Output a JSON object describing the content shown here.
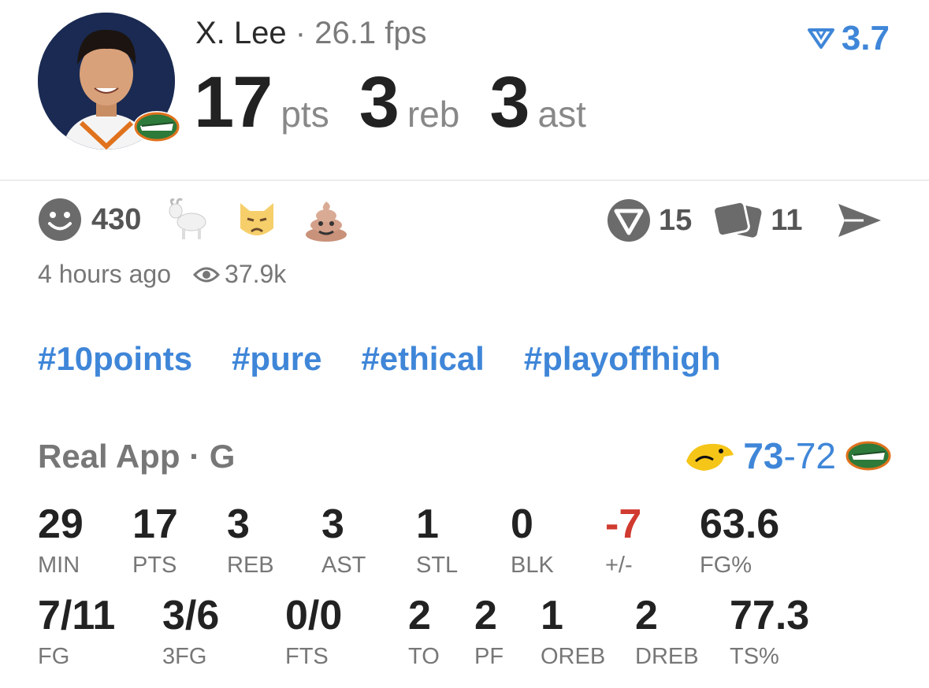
{
  "player": {
    "name": "X. Lee",
    "separator": "·",
    "fps": "26.1 fps"
  },
  "statline": [
    {
      "value": "17",
      "unit": "pts"
    },
    {
      "value": "3",
      "unit": "reb"
    },
    {
      "value": "3",
      "unit": "ast"
    }
  ],
  "rating": "3.7",
  "reactions": {
    "count": "430",
    "emojis": [
      "goat-emoji",
      "pouting-cat-emoji",
      "poop-emoji"
    ]
  },
  "actions": {
    "comments": "15",
    "cards": "11"
  },
  "meta": {
    "time": "4 hours ago",
    "views": "37.9k"
  },
  "tags": [
    "#10points",
    "#pure",
    "#ethical",
    "#playoffhigh"
  ],
  "game": {
    "title": "Real App · G",
    "score_home": "73",
    "score_dash": "-",
    "score_away": "72"
  },
  "box_row1": [
    {
      "value": "29",
      "label": "MIN"
    },
    {
      "value": "17",
      "label": "PTS"
    },
    {
      "value": "3",
      "label": "REB"
    },
    {
      "value": "3",
      "label": "AST"
    },
    {
      "value": "1",
      "label": "STL"
    },
    {
      "value": "0",
      "label": "BLK"
    },
    {
      "value": "-7",
      "label": "+/-"
    },
    {
      "value": "63.6",
      "label": "FG%"
    }
  ],
  "box_row2": [
    {
      "value": "7/11",
      "label": "FG"
    },
    {
      "value": "3/6",
      "label": "3FG"
    },
    {
      "value": "0/0",
      "label": "FTS"
    },
    {
      "value": "2",
      "label": "TO"
    },
    {
      "value": "2",
      "label": "PF"
    },
    {
      "value": "1",
      "label": "OREB"
    },
    {
      "value": "2",
      "label": "DREB"
    },
    {
      "value": "77.3",
      "label": "TS%"
    }
  ],
  "colors": {
    "accent": "#3f86d8",
    "negative": "#d03a2f",
    "muted": "#777777",
    "avatar_bg": "#1a2a52"
  }
}
